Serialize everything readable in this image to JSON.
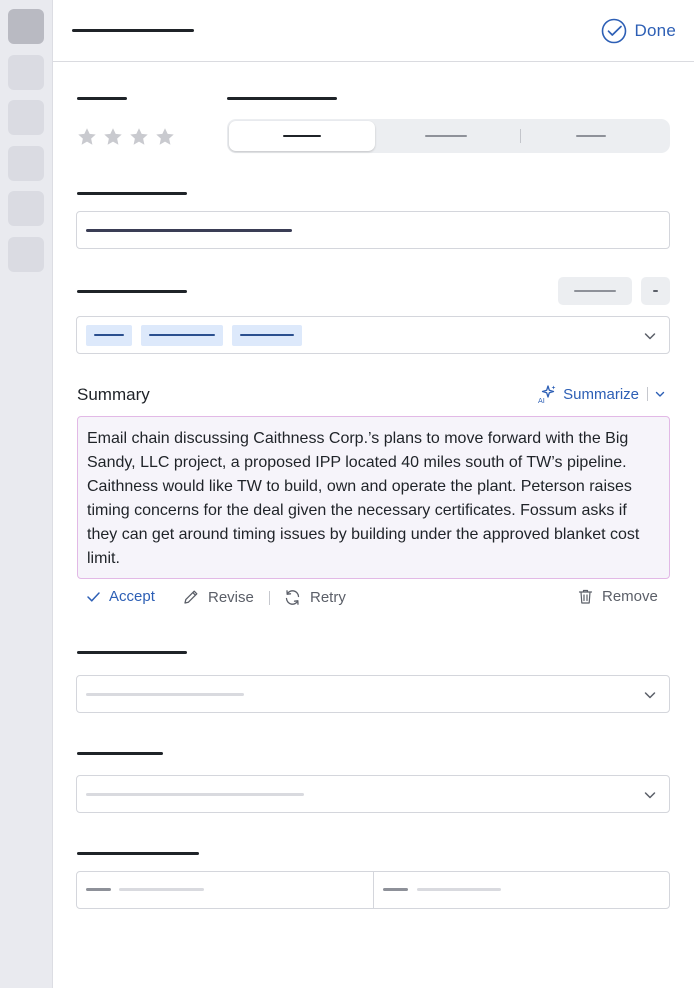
{
  "header": {
    "done_label": "Done"
  },
  "rating": {
    "value": 0,
    "max": 4
  },
  "summary": {
    "label": "Summary",
    "summarize_label": "Summarize",
    "text": "Email chain discussing Caithness Corp.’s plans to move forward with the Big Sandy, LLC project, a proposed IPP located 40 miles south of TW’s pipeline. Caithness would like TW to build, own and operate the plant. Peterson raises timing concerns for the deal given the necessary certificates. Fossum asks if they can get around timing issues by building under the approved blanket cost limit.",
    "actions": {
      "accept": "Accept",
      "revise": "Revise",
      "retry": "Retry",
      "remove": "Remove"
    }
  },
  "colors": {
    "accent": "#2d5fb5",
    "summary_border": "#e2b9e6",
    "summary_bg": "#f6f4fa",
    "chip_bg": "#dde9fb"
  },
  "icons": {
    "done": "check-circle-icon",
    "summarize": "ai-sparkle-icon",
    "accept": "check-icon",
    "revise": "pencil-icon",
    "retry": "refresh-icon",
    "remove": "trash-icon",
    "dropdown": "chevron-down-icon",
    "rating": "star-icon"
  }
}
